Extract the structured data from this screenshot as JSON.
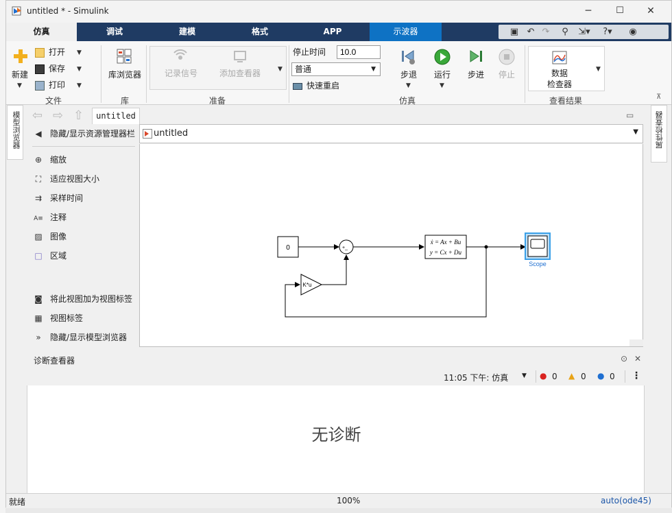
{
  "window": {
    "title": "untitled * - Simulink",
    "minimize_glyph": "─",
    "maximize_glyph": "☐",
    "close_glyph": "✕"
  },
  "tabs": [
    {
      "label": "仿真"
    },
    {
      "label": "调试"
    },
    {
      "label": "建模"
    },
    {
      "label": "格式"
    },
    {
      "label": "APP"
    },
    {
      "label": "示波器"
    }
  ],
  "ribbon": {
    "file": {
      "new_label": "新建",
      "open_label": "打开",
      "save_label": "保存",
      "print_label": "打印",
      "group_label": "文件"
    },
    "library": {
      "browser_label": "库浏览器",
      "group_label": "库"
    },
    "prepare": {
      "log_signals_label": "记录信号",
      "add_viewer_label": "添加查看器",
      "group_label": "准备"
    },
    "simulate": {
      "stop_time_label": "停止时间",
      "stop_time_value": "10.0",
      "mode_value": "普通",
      "fast_restart_label": "快速重启",
      "step_back_label": "步退",
      "run_label": "运行",
      "step_forward_label": "步进",
      "stop_label": "停止",
      "group_label": "仿真"
    },
    "review": {
      "inspector_label_line1": "数据",
      "inspector_label_line2": "检查器",
      "group_label": "查看结果"
    }
  },
  "side_rails": {
    "model_browser": "模型浏览器",
    "property_inspector": "属性检查器"
  },
  "breadcrumb_tab": "untitled",
  "palette": {
    "items": [
      {
        "label": "隐藏/显示资源管理器栏",
        "icon": "toggle-explorer-icon",
        "glyph": "◀"
      },
      {
        "label": "缩放",
        "icon": "zoom-icon",
        "glyph": "⊕"
      },
      {
        "label": "适应视图大小",
        "icon": "fit-view-icon",
        "glyph": "⛶"
      },
      {
        "label": "采样时间",
        "icon": "sample-time-icon",
        "glyph": "⇉"
      },
      {
        "label": "注释",
        "icon": "annotation-icon",
        "glyph": "A≡"
      },
      {
        "label": "图像",
        "icon": "image-icon",
        "glyph": "▨"
      },
      {
        "label": "区域",
        "icon": "area-icon",
        "glyph": "□"
      },
      {
        "label": "将此视图加为视图标签",
        "icon": "camera-icon",
        "glyph": "◙"
      },
      {
        "label": "视图标签",
        "icon": "viewmarks-icon",
        "glyph": "▦"
      },
      {
        "label": "隐藏/显示模型浏览器",
        "icon": "toggle-model-browser-icon",
        "glyph": "»"
      }
    ]
  },
  "address": {
    "text": "untitled"
  },
  "diagram": {
    "constant_value": "0",
    "sum_signs": "+_",
    "gain_label": "K*u",
    "ss_line1": "ẋ = Ax + Bu",
    "ss_line2": "y = Cx + Du",
    "scope_label": "Scope"
  },
  "diagnostics": {
    "title": "诊断查看器",
    "timestamp": "11:05 下午: 仿真",
    "errors": "0",
    "warnings": "0",
    "info": "0",
    "empty_message": "无诊断"
  },
  "status": {
    "left": "就绪",
    "zoom": "100%",
    "solver": "auto(ode45)"
  },
  "colors": {
    "tabbar": "#1f3b63",
    "scope_tab": "#0e72c4",
    "scope_highlight": "#3aa0e8",
    "solver_text": "#1b56a8"
  }
}
